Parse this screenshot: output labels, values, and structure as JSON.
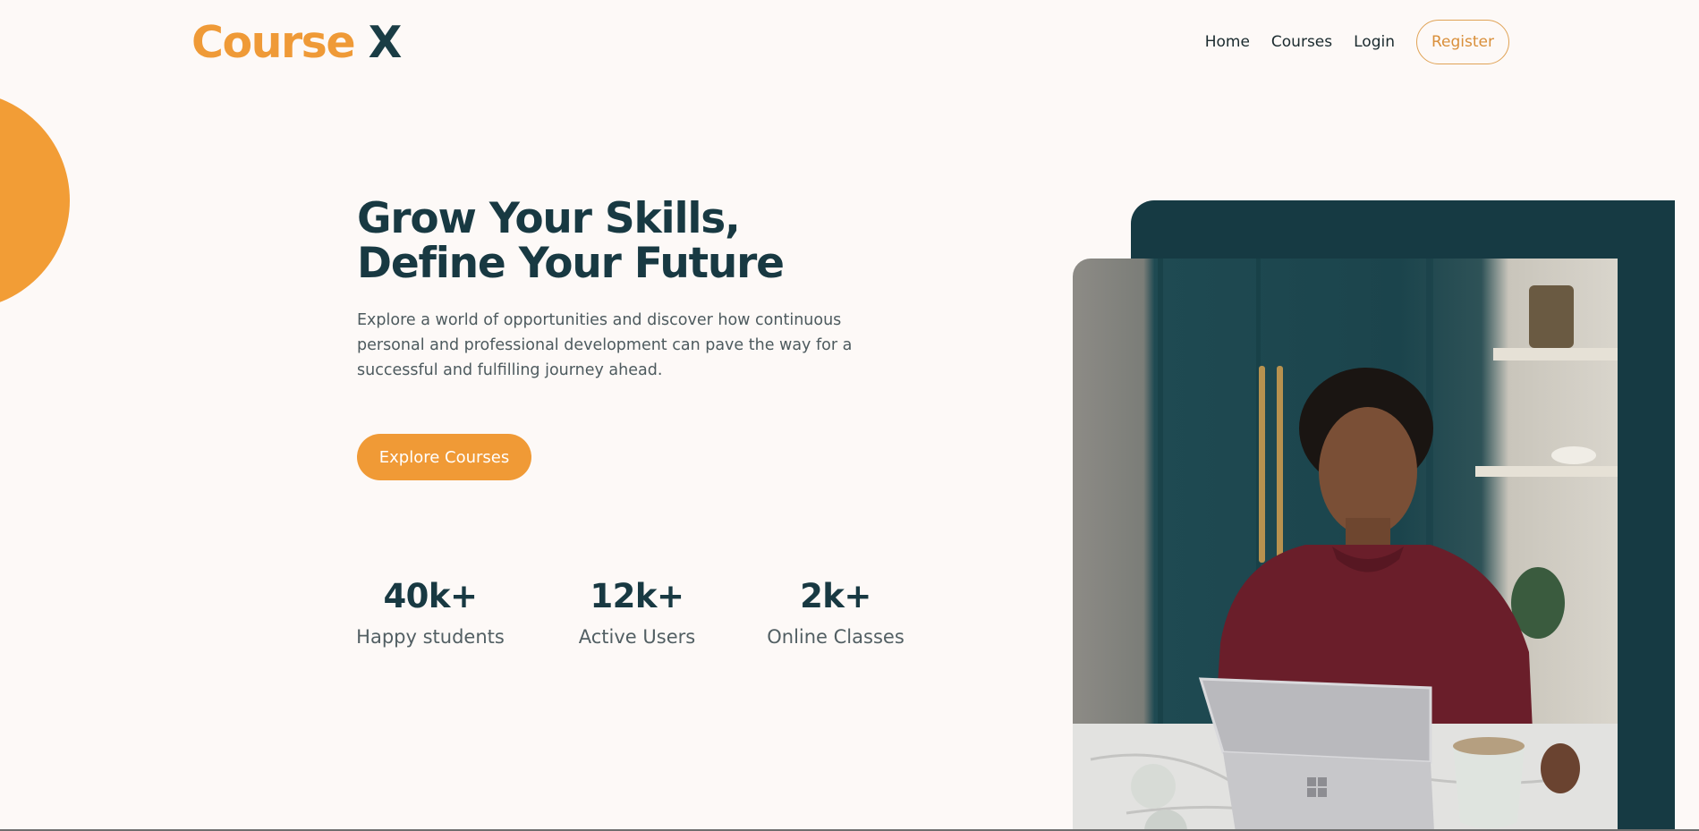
{
  "header": {
    "logo_part1": "Course",
    "logo_part2": "X",
    "nav": {
      "home": "Home",
      "courses": "Courses",
      "login": "Login",
      "register": "Register"
    }
  },
  "hero": {
    "title_line1": "Grow Your Skills,",
    "title_line2": "Define Your Future",
    "description": "Explore a world of opportunities and discover how continuous personal and professional development can pave the way for a successful and fulfilling journey ahead.",
    "cta_label": "Explore Courses"
  },
  "stats": [
    {
      "value": "40k+",
      "label": "Happy students"
    },
    {
      "value": "12k+",
      "label": "Active Users"
    },
    {
      "value": "2k+",
      "label": "Online Classes"
    }
  ],
  "colors": {
    "accent": "#f09a36",
    "brand_dark": "#183942",
    "background": "#fdf9f7"
  }
}
